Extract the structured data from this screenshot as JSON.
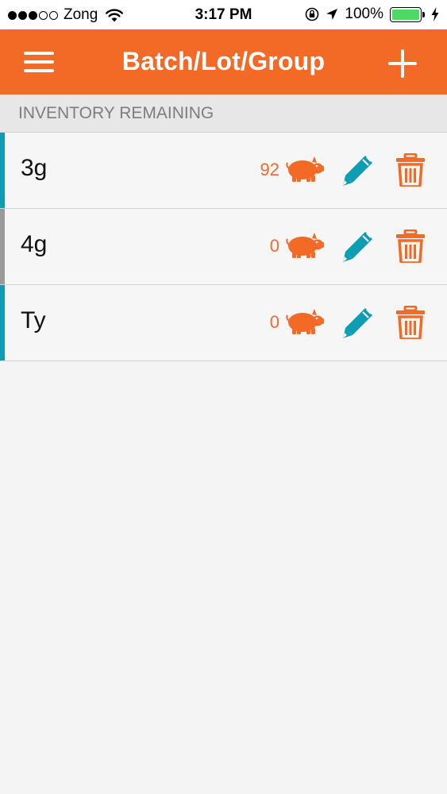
{
  "status_bar": {
    "carrier": "Zong",
    "time": "3:17 PM",
    "battery": "100%",
    "signal_bars_filled": 3,
    "signal_bars_total": 5
  },
  "nav": {
    "title": "Batch/Lot/Group",
    "menu_icon": "hamburger-menu-icon",
    "add_icon": "plus-icon"
  },
  "section": {
    "header": "INVENTORY REMAINING"
  },
  "colors": {
    "brand_orange": "#f26a25",
    "accent_teal": "#0f9db5",
    "accent_grey": "#9a9a9a",
    "battery_green": "#4cd964"
  },
  "rows": [
    {
      "name": "3g",
      "count": "92",
      "accent": "#0f9db5",
      "count_icon": "pig-icon",
      "edit_icon": "pencil-icon",
      "delete_icon": "trash-icon"
    },
    {
      "name": "4g",
      "count": "0",
      "accent": "#9a9a9a",
      "count_icon": "pig-icon",
      "edit_icon": "pencil-icon",
      "delete_icon": "trash-icon"
    },
    {
      "name": "Ty",
      "count": "0",
      "accent": "#0f9db5",
      "count_icon": "pig-icon",
      "edit_icon": "pencil-icon",
      "delete_icon": "trash-icon"
    }
  ]
}
